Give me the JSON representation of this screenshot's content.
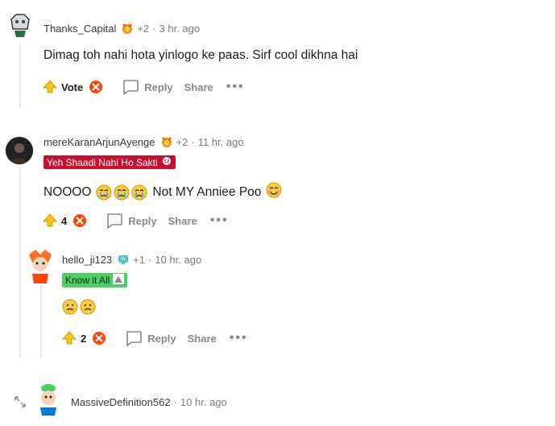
{
  "comments": [
    {
      "username": "Thanks_Capital",
      "extra_awards": "+2",
      "time": "3 hr. ago",
      "body": "Dimag toh nahi hota yinlogo ke paas. Sirf cool dikhna hai",
      "vote_label": "Vote",
      "reply": "Reply",
      "share": "Share",
      "more": "•••"
    },
    {
      "username": "mereKaranArjunAyenge",
      "extra_awards": "+2",
      "time": "11 hr. ago",
      "flair": "Yeh Shaadi Nahi Ho Sakti",
      "body_text": "NOOOO",
      "body_text2": "Not MY Anniee Poo",
      "vote_label": "4",
      "reply": "Reply",
      "share": "Share",
      "more": "•••"
    },
    {
      "username": "hello_ji123",
      "extra_awards": "+1",
      "time": "10 hr. ago",
      "flair": "Know it All",
      "vote_label": "2",
      "reply": "Reply",
      "share": "Share",
      "more": "•••"
    },
    {
      "username": "MassiveDefinition562",
      "time": "10 hr. ago"
    }
  ],
  "separator": "·",
  "colors": {
    "upvote": "#f5c518",
    "downvote": "#ff4500",
    "flair_red": "#c8102e",
    "flair_green": "#46d160"
  }
}
